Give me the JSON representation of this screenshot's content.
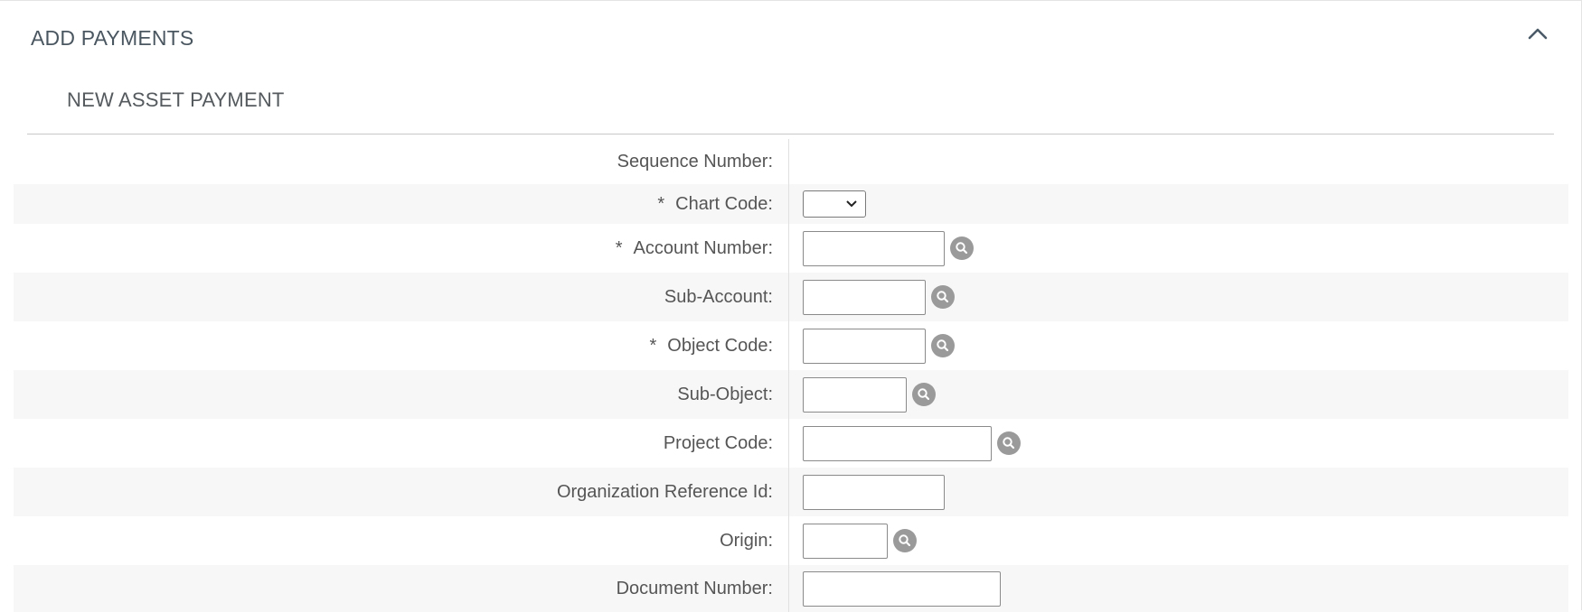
{
  "header": {
    "title": "ADD PAYMENTS",
    "collapse_icon": "chevron-up-icon"
  },
  "subsection": {
    "title": "NEW ASSET PAYMENT"
  },
  "fields": {
    "sequence_number": {
      "label": "Sequence Number:",
      "value": ""
    },
    "chart_code": {
      "required": "*",
      "label": "Chart Code:",
      "value": ""
    },
    "account_number": {
      "required": "*",
      "label": "Account Number:",
      "value": ""
    },
    "sub_account": {
      "label": "Sub-Account:",
      "value": ""
    },
    "object_code": {
      "required": "*",
      "label": "Object Code:",
      "value": ""
    },
    "sub_object": {
      "label": "Sub-Object:",
      "value": ""
    },
    "project_code": {
      "label": "Project Code:",
      "value": ""
    },
    "organization_reference_id": {
      "label": "Organization Reference Id:",
      "value": ""
    },
    "origin": {
      "label": "Origin:",
      "value": ""
    },
    "document_number": {
      "label": "Document Number:",
      "value": ""
    }
  },
  "colors": {
    "lookup_icon_bg": "#9a9a9a",
    "alt_row_bg": "#f7f7f7",
    "title_text": "#4a5660"
  }
}
